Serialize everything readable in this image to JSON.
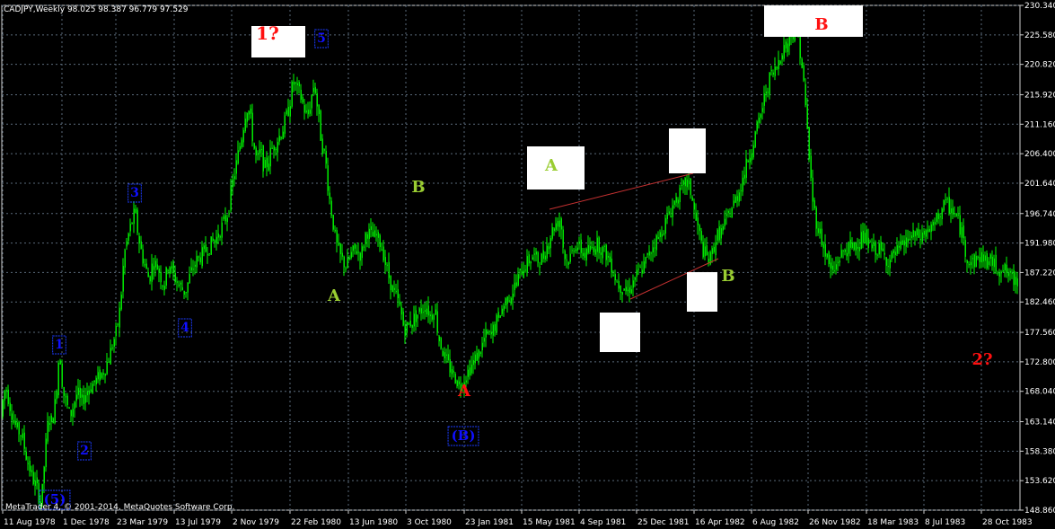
{
  "window": {
    "header": "CADJPY,Weekly  98.025 98.387 96.779 97.529",
    "copyright": "MetaTrader 4, © 2001-2014, MetaQuotes Software Corp."
  },
  "colors": {
    "background": "#000000",
    "grid": "#5a6a7a",
    "bull_candle": "#00ff00",
    "bear_candle": "#00ff00",
    "axis_text": "#ffffff",
    "wave_blue": "#1010ff",
    "wave_green": "#9acd32",
    "wave_red": "#ff1010",
    "trendline": "#c83232"
  },
  "chart_data": {
    "type": "candlestick",
    "title": "CADJPY,Weekly",
    "ohlc_last": {
      "open": 98.025,
      "high": 98.387,
      "low": 96.779,
      "close": 97.529
    },
    "y_ticks": [
      "230.340",
      "225.580",
      "220.820",
      "215.920",
      "211.160",
      "206.400",
      "201.640",
      "196.740",
      "191.980",
      "187.220",
      "182.460",
      "177.560",
      "172.800",
      "168.040",
      "163.140",
      "158.380",
      "153.620",
      "148.860"
    ],
    "x_ticks": [
      "11 Aug 1978",
      "1 Dec 1978",
      "23 Mar 1979",
      "13 Jul 1979",
      "2 Nov 1979",
      "22 Feb 1980",
      "13 Jun 1980",
      "3 Oct 1980",
      "23 Jan 1981",
      "15 May 1981",
      "4 Sep 1981",
      "25 Dec 1981",
      "16 Apr 1982",
      "6 Aug 1982",
      "26 Nov 1982",
      "18 Mar 1983",
      "8 Jul 1983",
      "28 Oct 1983"
    ],
    "ylim": [
      148.86,
      230.34
    ],
    "grid": true,
    "price_path": [
      [
        0,
        164
      ],
      [
        6,
        169
      ],
      [
        12,
        165
      ],
      [
        18,
        162
      ],
      [
        24,
        161
      ],
      [
        30,
        157
      ],
      [
        36,
        154
      ],
      [
        42,
        152
      ],
      [
        46,
        150
      ],
      [
        50,
        158
      ],
      [
        54,
        164
      ],
      [
        58,
        163
      ],
      [
        62,
        167
      ],
      [
        66,
        175
      ],
      [
        70,
        168
      ],
      [
        74,
        166
      ],
      [
        78,
        164
      ],
      [
        82,
        166
      ],
      [
        86,
        168
      ],
      [
        90,
        166
      ],
      [
        96,
        168
      ],
      [
        102,
        169
      ],
      [
        108,
        170
      ],
      [
        114,
        171
      ],
      [
        120,
        173
      ],
      [
        126,
        176
      ],
      [
        130,
        178
      ],
      [
        134,
        182
      ],
      [
        138,
        190
      ],
      [
        144,
        194
      ],
      [
        150,
        197
      ],
      [
        154,
        193
      ],
      [
        158,
        190
      ],
      [
        162,
        188
      ],
      [
        166,
        186
      ],
      [
        170,
        189
      ],
      [
        176,
        188
      ],
      [
        182,
        185
      ],
      [
        188,
        189
      ],
      [
        192,
        187
      ],
      [
        196,
        186
      ],
      [
        200,
        185
      ],
      [
        206,
        184
      ],
      [
        212,
        187
      ],
      [
        218,
        189
      ],
      [
        224,
        190
      ],
      [
        230,
        191
      ],
      [
        236,
        192
      ],
      [
        242,
        193
      ],
      [
        248,
        195
      ],
      [
        254,
        197
      ],
      [
        258,
        201
      ],
      [
        262,
        204
      ],
      [
        266,
        207
      ],
      [
        270,
        210
      ],
      [
        274,
        214
      ],
      [
        278,
        213
      ],
      [
        282,
        208
      ],
      [
        286,
        205
      ],
      [
        290,
        207
      ],
      [
        294,
        204
      ],
      [
        298,
        205
      ],
      [
        302,
        207
      ],
      [
        306,
        208
      ],
      [
        310,
        209
      ],
      [
        314,
        210
      ],
      [
        318,
        212
      ],
      [
        322,
        214
      ],
      [
        326,
        218
      ],
      [
        330,
        217
      ],
      [
        334,
        216
      ],
      [
        338,
        214
      ],
      [
        342,
        212
      ],
      [
        346,
        215
      ],
      [
        350,
        218
      ],
      [
        354,
        213
      ],
      [
        358,
        208
      ],
      [
        362,
        206
      ],
      [
        366,
        200
      ],
      [
        370,
        196
      ],
      [
        374,
        192
      ],
      [
        378,
        190
      ],
      [
        382,
        189
      ],
      [
        386,
        188
      ],
      [
        390,
        190
      ],
      [
        396,
        191
      ],
      [
        402,
        190
      ],
      [
        408,
        194
      ],
      [
        414,
        193
      ],
      [
        420,
        193
      ],
      [
        426,
        191
      ],
      [
        430,
        188
      ],
      [
        434,
        186
      ],
      [
        438,
        184
      ],
      [
        442,
        183
      ],
      [
        446,
        181
      ],
      [
        450,
        178
      ],
      [
        456,
        179
      ],
      [
        462,
        180
      ],
      [
        468,
        181
      ],
      [
        474,
        182
      ],
      [
        480,
        180
      ],
      [
        484,
        182
      ],
      [
        488,
        177
      ],
      [
        492,
        175
      ],
      [
        496,
        173
      ],
      [
        500,
        172
      ],
      [
        504,
        171
      ],
      [
        508,
        170
      ],
      [
        512,
        169
      ],
      [
        516,
        170
      ],
      [
        520,
        171
      ],
      [
        524,
        172
      ],
      [
        528,
        173
      ],
      [
        532,
        174
      ],
      [
        536,
        175
      ],
      [
        540,
        177
      ],
      [
        546,
        177
      ],
      [
        552,
        179
      ],
      [
        558,
        181
      ],
      [
        564,
        183
      ],
      [
        570,
        184
      ],
      [
        576,
        186
      ],
      [
        582,
        188
      ],
      [
        588,
        189
      ],
      [
        594,
        190
      ],
      [
        600,
        189
      ],
      [
        606,
        190
      ],
      [
        612,
        193
      ],
      [
        618,
        195
      ],
      [
        624,
        196
      ],
      [
        628,
        190
      ],
      [
        632,
        189
      ],
      [
        636,
        190
      ],
      [
        640,
        192
      ],
      [
        646,
        191
      ],
      [
        652,
        190
      ],
      [
        658,
        191
      ],
      [
        664,
        192
      ],
      [
        670,
        191
      ],
      [
        676,
        190
      ],
      [
        682,
        188
      ],
      [
        686,
        186
      ],
      [
        690,
        185
      ],
      [
        694,
        185
      ],
      [
        698,
        184
      ],
      [
        702,
        185
      ],
      [
        706,
        186
      ],
      [
        710,
        187
      ],
      [
        716,
        188
      ],
      [
        722,
        190
      ],
      [
        728,
        192
      ],
      [
        734,
        193
      ],
      [
        740,
        195
      ],
      [
        746,
        197
      ],
      [
        752,
        199
      ],
      [
        758,
        200
      ],
      [
        764,
        202
      ],
      [
        770,
        200
      ],
      [
        774,
        196
      ],
      [
        778,
        194
      ],
      [
        782,
        191
      ],
      [
        786,
        190
      ],
      [
        790,
        189
      ],
      [
        794,
        191
      ],
      [
        798,
        193
      ],
      [
        804,
        194
      ],
      [
        810,
        196
      ],
      [
        816,
        198
      ],
      [
        822,
        200
      ],
      [
        828,
        203
      ],
      [
        834,
        206
      ],
      [
        840,
        209
      ],
      [
        846,
        212
      ],
      [
        852,
        216
      ],
      [
        858,
        219
      ],
      [
        864,
        220
      ],
      [
        870,
        223
      ],
      [
        876,
        224
      ],
      [
        882,
        226
      ],
      [
        888,
        226
      ],
      [
        892,
        222
      ],
      [
        896,
        216
      ],
      [
        900,
        208
      ],
      [
        904,
        200
      ],
      [
        908,
        196
      ],
      [
        912,
        194
      ],
      [
        916,
        192
      ],
      [
        920,
        190
      ],
      [
        924,
        188
      ],
      [
        928,
        187
      ],
      [
        932,
        189
      ],
      [
        936,
        190
      ],
      [
        942,
        191
      ],
      [
        948,
        191
      ],
      [
        954,
        192
      ],
      [
        960,
        193
      ],
      [
        966,
        192
      ],
      [
        972,
        191
      ],
      [
        978,
        191
      ],
      [
        984,
        190
      ],
      [
        990,
        189
      ],
      [
        996,
        190
      ],
      [
        1002,
        191
      ],
      [
        1008,
        192
      ],
      [
        1014,
        193
      ],
      [
        1020,
        193
      ],
      [
        1026,
        193
      ],
      [
        1032,
        194
      ],
      [
        1038,
        194
      ],
      [
        1044,
        196
      ],
      [
        1050,
        198
      ],
      [
        1056,
        198
      ],
      [
        1062,
        197
      ],
      [
        1068,
        195
      ],
      [
        1072,
        193
      ],
      [
        1076,
        190
      ],
      [
        1080,
        189
      ],
      [
        1086,
        189
      ],
      [
        1092,
        190
      ],
      [
        1098,
        189
      ],
      [
        1104,
        189
      ],
      [
        1110,
        188
      ],
      [
        1116,
        188
      ],
      [
        1122,
        187
      ],
      [
        1128,
        186
      ],
      [
        1133,
        186
      ]
    ],
    "annotations": [
      {
        "text": "(5)",
        "color": "wave_blue",
        "boxed": true
      },
      {
        "text": "1",
        "color": "wave_blue",
        "boxed": true
      },
      {
        "text": "2",
        "color": "wave_blue",
        "boxed": true
      },
      {
        "text": "3",
        "color": "wave_blue",
        "boxed": true
      },
      {
        "text": "4",
        "color": "wave_blue",
        "boxed": true
      },
      {
        "text": "5",
        "color": "wave_blue",
        "boxed": true
      },
      {
        "text": "1?",
        "color": "wave_red",
        "boxed": false
      },
      {
        "text": "A",
        "color": "wave_green",
        "boxed": false
      },
      {
        "text": "B",
        "color": "wave_green",
        "boxed": false
      },
      {
        "text": "A",
        "color": "wave_red",
        "boxed": false
      },
      {
        "text": "(B)",
        "color": "wave_blue",
        "boxed": true
      },
      {
        "text": "A",
        "color": "wave_green",
        "boxed": false
      },
      {
        "text": "B",
        "color": "wave_green",
        "boxed": false
      },
      {
        "text": "B",
        "color": "wave_red",
        "boxed": false
      },
      {
        "text": "2?",
        "color": "wave_red",
        "boxed": false
      }
    ]
  }
}
